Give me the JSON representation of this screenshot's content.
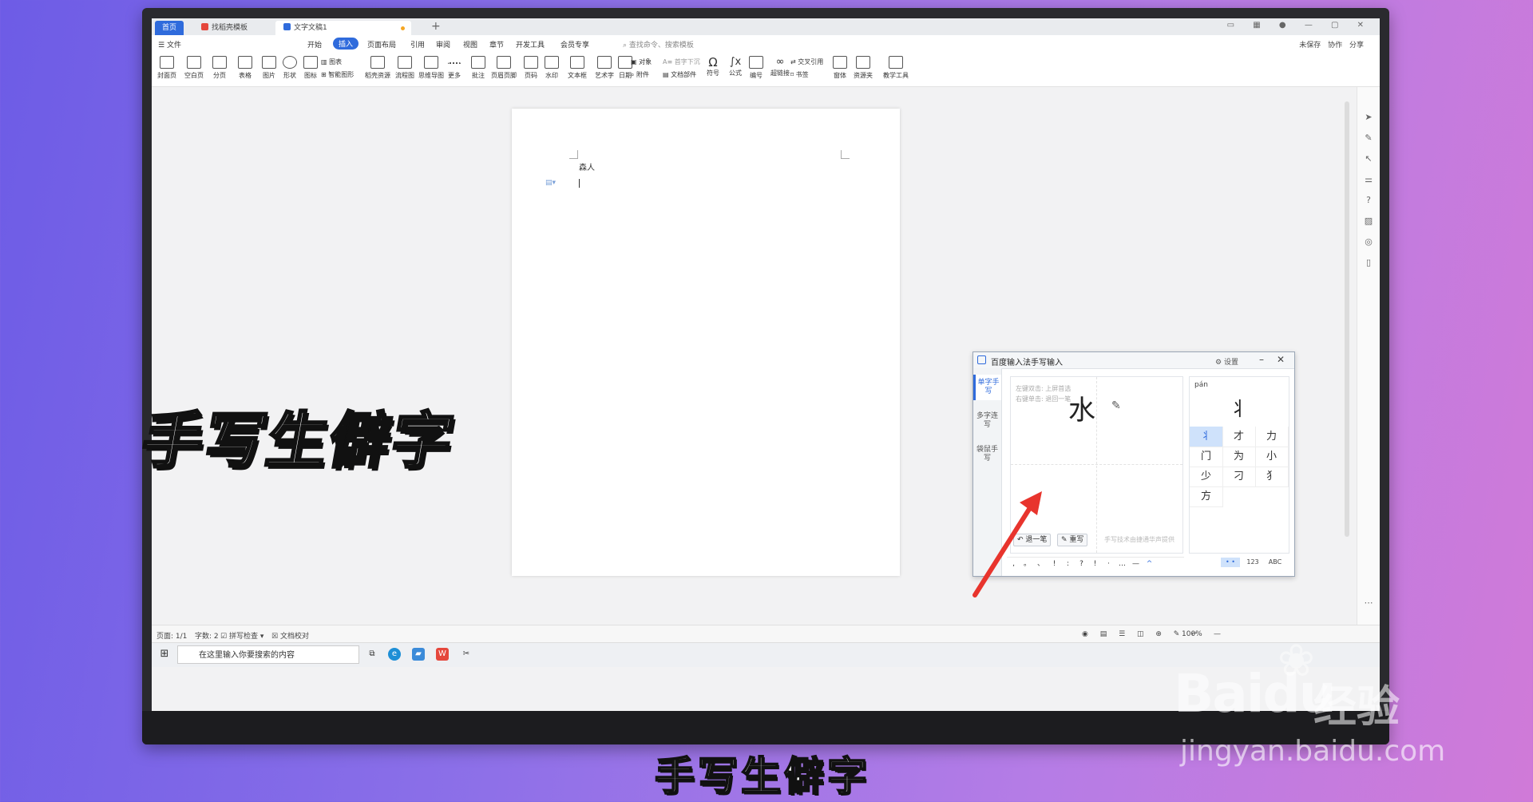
{
  "tabs": {
    "home": "首页",
    "template": "找稻壳模板",
    "doc": "文字文稿1"
  },
  "menu": {
    "file": "文件",
    "items": [
      "开始",
      "插入",
      "页面布局",
      "引用",
      "审阅",
      "视图",
      "章节",
      "开发工具",
      "会员专享"
    ],
    "active": "插入",
    "search": "查找命令、搜索模板",
    "right": "未保存 协作 分享"
  },
  "ribbon": [
    "封面页",
    "空白页",
    "分页",
    "表格",
    "图片",
    "形状",
    "图标",
    "稻壳资源",
    "流程图",
    "思维导图",
    "更多",
    "批注",
    "页眉页脚",
    "页码",
    "水印",
    "文本框",
    "艺术字",
    "日期",
    "符号",
    "公式",
    "编号",
    "超链接",
    "窗体",
    "资源夹",
    "教学工具"
  ],
  "ribbon_small": {
    "chart": "图表",
    "smart": "智能图形",
    "object": "对象",
    "dropcap": "首字下沉",
    "attach": "附件",
    "docpart": "文档部件",
    "crossref": "交叉引用",
    "bookmark": "书签"
  },
  "doc": {
    "text": "森人"
  },
  "status": {
    "page": "页面: 1/1",
    "words": "字数: 2",
    "spell": "拼写检查",
    "proof": "文档校对",
    "zoom": "100%"
  },
  "taskbar": {
    "search": "在这里输入你要搜索的内容"
  },
  "ime": {
    "title": "百度输入法手写输入",
    "settings": "设置",
    "modes": [
      "单字手写",
      "多字连写",
      "袋鼠手写"
    ],
    "hint1": "左键双击: 上屏首选",
    "hint2": "右键单击: 退回一笔",
    "stroke": "水",
    "undo": "退一笔",
    "rewrite": "重写",
    "tech": "手写技术由捷通华声提供",
    "punct": [
      ",",
      "。",
      "、",
      "!",
      ":",
      "?",
      "!",
      "·",
      "…",
      "—",
      "^"
    ],
    "pinyin": "pán",
    "big": "丬",
    "candidates": [
      "丬",
      "才",
      "力",
      "门",
      "为",
      "小",
      "少",
      "刁",
      "犭",
      "方"
    ],
    "bottom": [
      "• •",
      "123",
      "ABC"
    ]
  },
  "captions": {
    "left": "手写生僻字",
    "bottom": "手写生僻字"
  },
  "watermark": {
    "brand": "Baidu",
    "jingyan": "经验",
    "url": "jingyan.baidu.com"
  },
  "colors": {
    "accent": "#2f6bdc",
    "arrow": "#e8342d"
  }
}
